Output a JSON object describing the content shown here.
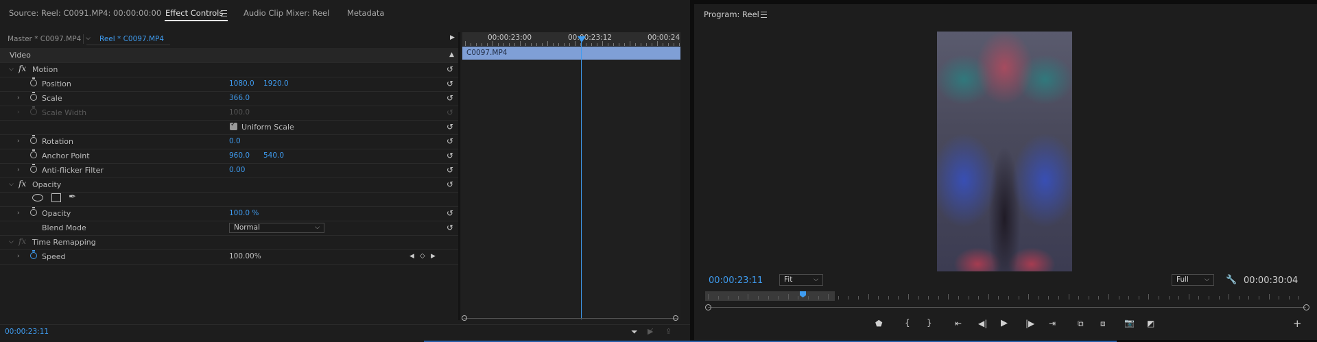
{
  "effect_panel": {
    "tabs": [
      {
        "label": "Source: Reel: C0091.MP4: 00:00:00:00"
      },
      {
        "label": "Effect Controls"
      },
      {
        "label": "Audio Clip Mixer: Reel"
      },
      {
        "label": "Metadata"
      }
    ],
    "subtabs": {
      "master": "Master * C0097.MP4",
      "reel": "Reel * C0097.MP4"
    },
    "section_video": "Video",
    "fx_symbol": "fx",
    "motion": {
      "label": "Motion",
      "position": {
        "label": "Position",
        "x": "1080.0",
        "y": "1920.0"
      },
      "scale": {
        "label": "Scale",
        "value": "366.0"
      },
      "scale_width": {
        "label": "Scale Width",
        "value": "100.0"
      },
      "uniform_scale": {
        "label": "Uniform Scale",
        "checked": true
      },
      "rotation": {
        "label": "Rotation",
        "value": "0.0"
      },
      "anchor_point": {
        "label": "Anchor Point",
        "x": "960.0",
        "y": "540.0"
      },
      "anti_flicker": {
        "label": "Anti-flicker Filter",
        "value": "0.00"
      }
    },
    "opacity": {
      "label": "Opacity",
      "opacity_param": {
        "label": "Opacity",
        "value": "100.0 %"
      },
      "blend_mode": {
        "label": "Blend Mode",
        "value": "Normal"
      }
    },
    "time_remapping": {
      "label": "Time Remapping",
      "speed": {
        "label": "Speed",
        "value": "100.00%"
      }
    },
    "timeline": {
      "ruler": [
        "00:00:23:00",
        "00:00:23:12",
        "00:00:24"
      ],
      "clip_name": "C0097.MP4"
    },
    "current_time": "00:00:23:11"
  },
  "program_monitor": {
    "title": "Program: Reel",
    "current_time": "00:00:23:11",
    "zoom": "Fit",
    "resolution": "Full",
    "duration": "00:00:30:04"
  },
  "colors": {
    "accent": "#3f9cf0",
    "clip": "#7f9fd6",
    "panel": "#1d1d1d"
  }
}
